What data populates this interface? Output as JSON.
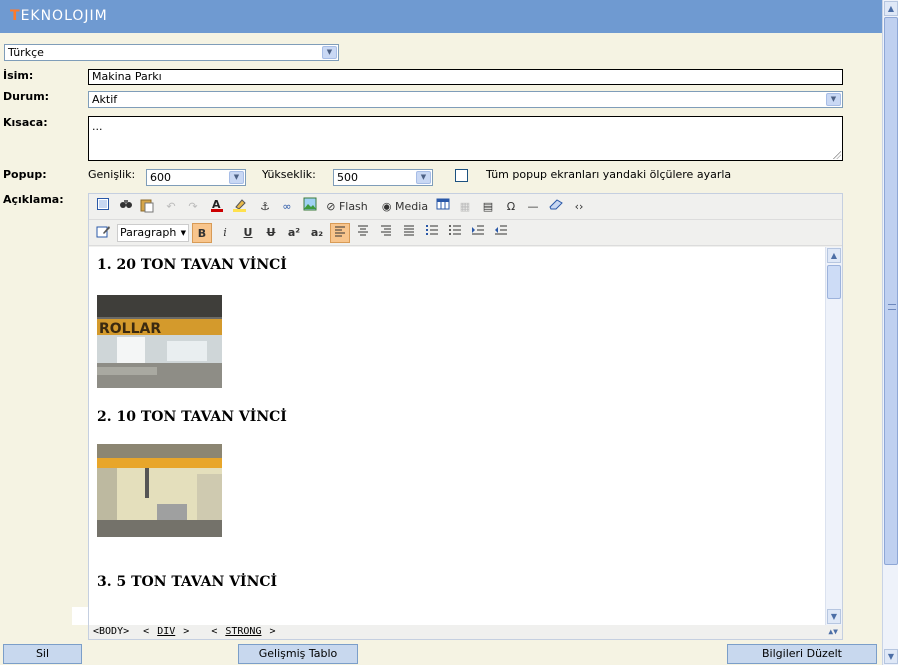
{
  "app": {
    "title": "TEKNOLOJIM",
    "title_first": "T",
    "title_rest": "EKNOLOJIM"
  },
  "language_select": {
    "value": "Türkçe"
  },
  "form": {
    "name_label": "İsim:",
    "name_value": "Makina Parkı",
    "status_label": "Durum:",
    "status_value": "Aktif",
    "short_label": "Kısaca:",
    "short_value": "...",
    "popup_label": "Popup:",
    "width_label": "Genişlik:",
    "width_value": "600",
    "height_label": "Yükseklik:",
    "height_value": "500",
    "popup_all_label": "Tüm popup ekranları yandaki ölçülere ayarla",
    "description_label": "Açıklama:"
  },
  "editor": {
    "toolbar1": {
      "flash_label": "Flash",
      "media_label": "Media"
    },
    "toolbar2": {
      "format_value": "Paragraph",
      "bold": "B",
      "italic": "i",
      "underline": "U",
      "strike": "U",
      "superscript": "a²",
      "subscript": "a₂"
    },
    "content": {
      "headings": [
        "1. 20 TON TAVAN VİNCİ",
        "2. 10 TON TAVAN VİNCİ",
        "3. 5 TON TAVAN VİNCİ"
      ],
      "photo1_text": "ROLLAR"
    },
    "statusbar": {
      "path1": "<BODY>",
      "path2a": "<",
      "path2": "DIV",
      "path2b": ">",
      "path3a": "<",
      "path3": "STRONG",
      "path3b": ">"
    }
  },
  "buttons": {
    "delete": "Sil",
    "advanced_table": "Gelişmiş Tablo",
    "update": "Bilgileri Düzelt"
  },
  "colors": {
    "titlebar": "#6f9ad1",
    "page_bg": "#f5f3e3",
    "button_bg": "#c8d8ee",
    "active_toolbar": "#f8c58c"
  }
}
